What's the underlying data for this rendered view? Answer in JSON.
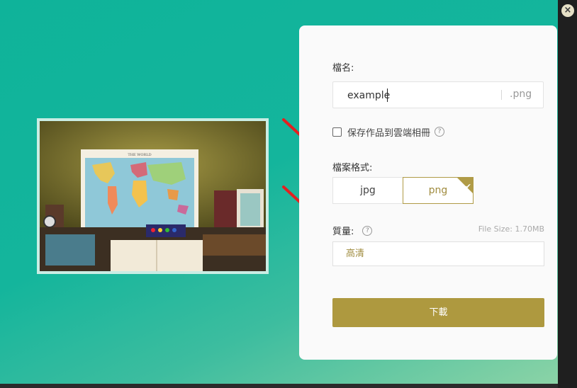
{
  "dialog": {
    "filename_label": "檔名:",
    "filename_value": "example",
    "extension": ".png",
    "save_cloud_label": "保存作品到雲端相冊",
    "help_glyph": "?",
    "format_label": "檔案格式:",
    "formats": [
      "jpg",
      "png"
    ],
    "selected_format": "png",
    "quality_label": "質量:",
    "file_size": "File Size: 1.70MB",
    "quality_value": "高清",
    "download_label": "下載",
    "close_glyph": "×"
  },
  "preview": {
    "map_title": "THE WORLD"
  },
  "colors": {
    "accent": "#ae993f",
    "background": "#14b59c",
    "arrow": "#e32020"
  },
  "icons": [
    "close-icon",
    "help-icon",
    "checkbox",
    "check-icon",
    "arrow"
  ]
}
